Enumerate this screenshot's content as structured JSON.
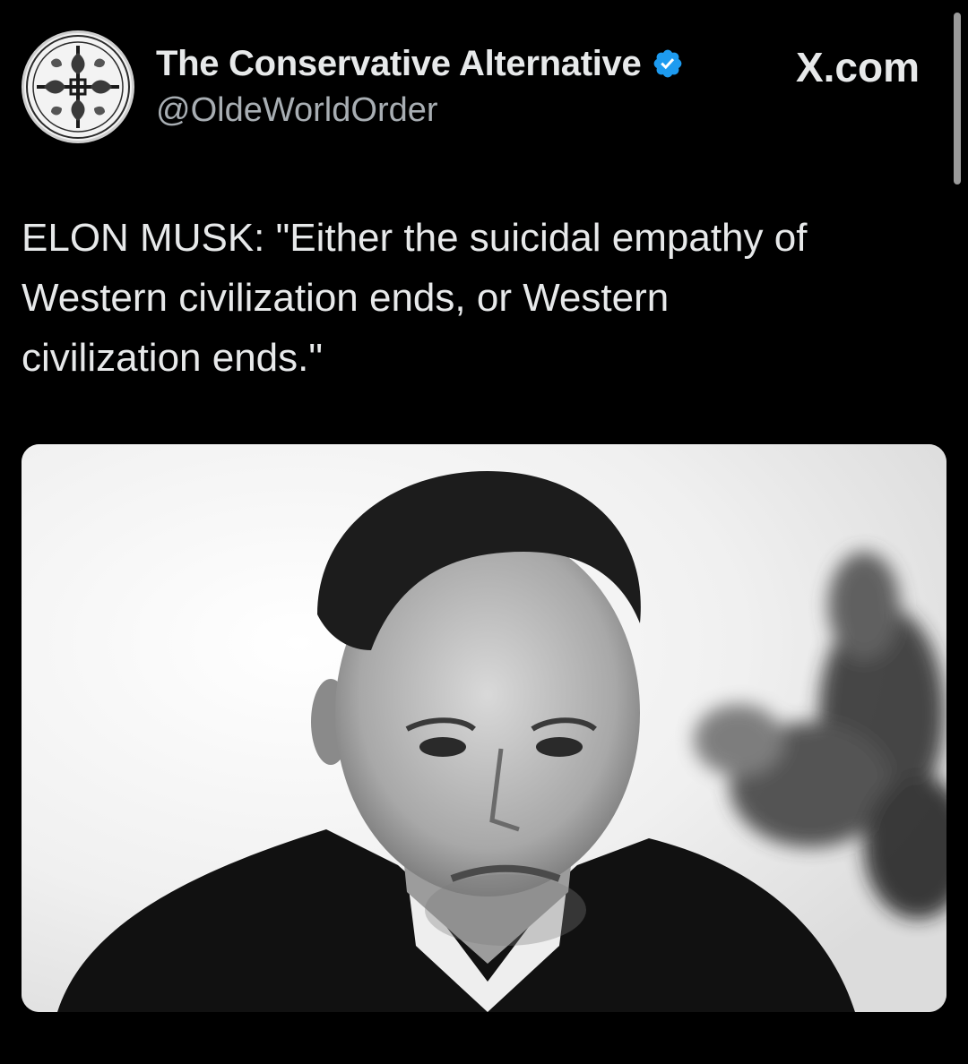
{
  "author": {
    "display_name": "The Conservative Alternative",
    "handle": "@OldeWorldOrder",
    "verified": true,
    "verified_icon": "verified-badge-icon",
    "verified_color": "#1d9bf0"
  },
  "brand": {
    "label": "X.com"
  },
  "tweet": {
    "lines": [
      "ELON MUSK: \"Either the suicidal empathy of",
      "Western civilization ends, or Western",
      "civilization ends.\""
    ]
  },
  "colors": {
    "background": "#000000",
    "text": "#e7e9ea",
    "secondary_text": "#a8aeb3",
    "accent": "#1d9bf0"
  }
}
